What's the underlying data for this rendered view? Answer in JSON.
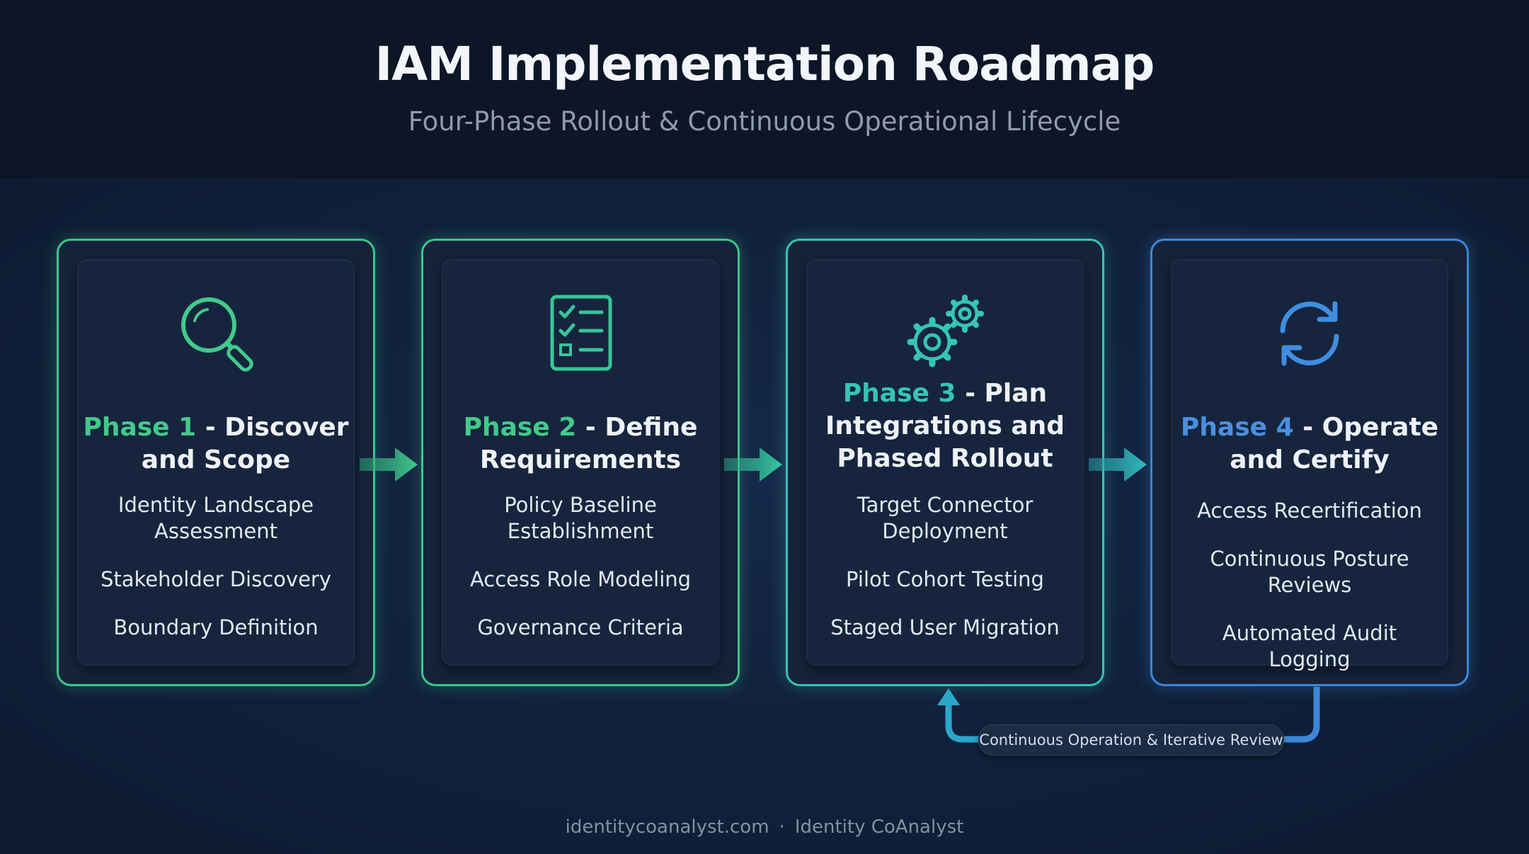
{
  "header": {
    "title": "IAM Implementation Roadmap",
    "subtitle": "Four-Phase Rollout & Continuous Operational Lifecycle"
  },
  "phases": [
    {
      "number_label": "Phase 1",
      "title_rest": " - Discover and Scope",
      "icon": "magnifier-icon",
      "accent": "#43c98c",
      "items": [
        "Identity Landscape Assessment",
        "Stakeholder Discovery",
        "Boundary Definition"
      ]
    },
    {
      "number_label": "Phase 2",
      "title_rest": " - Define Requirements",
      "icon": "checklist-icon",
      "accent": "#36c59a",
      "items": [
        "Policy Baseline Establishment",
        "Access Role Modeling",
        "Governance Criteria"
      ]
    },
    {
      "number_label": "Phase 3",
      "title_rest": " - Plan Integrations and Phased Rollout",
      "icon": "gears-icon",
      "accent": "#36c5b2",
      "items": [
        "Target Connector Deployment",
        "Pilot Cohort Testing",
        "Staged User Migration"
      ]
    },
    {
      "number_label": "Phase 4",
      "title_rest": " - Operate and Certify",
      "icon": "refresh-cycle-icon",
      "accent": "#4a90e0",
      "items": [
        "Access Recertification",
        "Continuous Posture Reviews",
        "Automated Audit Logging"
      ]
    }
  ],
  "loop": {
    "label": "Continuous Operation & Iterative Review"
  },
  "footer": {
    "site": "identitycoanalyst.com",
    "separator": "·",
    "brand": "Identity CoAnalyst"
  }
}
